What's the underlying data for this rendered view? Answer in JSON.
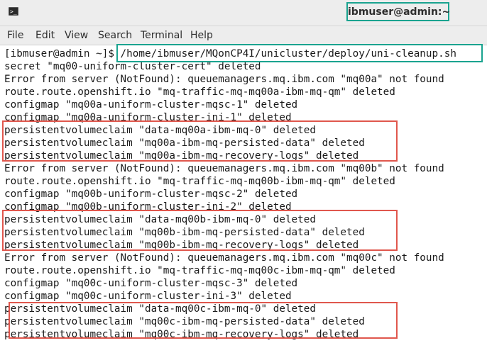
{
  "window": {
    "title": "ibmuser@admin:~",
    "icon": "terminal-icon",
    "accent_teal": "#1aa38f",
    "highlight_red": "#e0574d"
  },
  "menu": {
    "items": [
      "File",
      "Edit",
      "View",
      "Search",
      "Terminal",
      "Help"
    ]
  },
  "terminal": {
    "lines": [
      "[ibmuser@admin ~]$ /home/ibmuser/MQonCP4I/unicluster/deploy/uni-cleanup.sh",
      "secret \"mq00-uniform-cluster-cert\" deleted",
      "Error from server (NotFound): queuemanagers.mq.ibm.com \"mq00a\" not found",
      "route.route.openshift.io \"mq-traffic-mq-mq00a-ibm-mq-qm\" deleted",
      "configmap \"mq00a-uniform-cluster-mqsc-1\" deleted",
      "configmap \"mq00a-uniform-cluster-ini-1\" deleted",
      "persistentvolumeclaim \"data-mq00a-ibm-mq-0\" deleted",
      "persistentvolumeclaim \"mq00a-ibm-mq-persisted-data\" deleted",
      "persistentvolumeclaim \"mq00a-ibm-mq-recovery-logs\" deleted",
      "Error from server (NotFound): queuemanagers.mq.ibm.com \"mq00b\" not found",
      "route.route.openshift.io \"mq-traffic-mq-mq00b-ibm-mq-qm\" deleted",
      "configmap \"mq00b-uniform-cluster-mqsc-2\" deleted",
      "configmap \"mq00b-uniform-cluster-ini-2\" deleted",
      "persistentvolumeclaim \"data-mq00b-ibm-mq-0\" deleted",
      "persistentvolumeclaim \"mq00b-ibm-mq-persisted-data\" deleted",
      "persistentvolumeclaim \"mq00b-ibm-mq-recovery-logs\" deleted",
      "Error from server (NotFound): queuemanagers.mq.ibm.com \"mq00c\" not found",
      "route.route.openshift.io \"mq-traffic-mq-mq00c-ibm-mq-qm\" deleted",
      "configmap \"mq00c-uniform-cluster-mqsc-3\" deleted",
      "configmap \"mq00c-uniform-cluster-ini-3\" deleted",
      "persistentvolumeclaim \"data-mq00c-ibm-mq-0\" deleted",
      "persistentvolumeclaim \"mq00c-ibm-mq-persisted-data\" deleted",
      "persistentvolumeclaim \"mq00c-ibm-mq-recovery-logs\" deleted"
    ]
  }
}
